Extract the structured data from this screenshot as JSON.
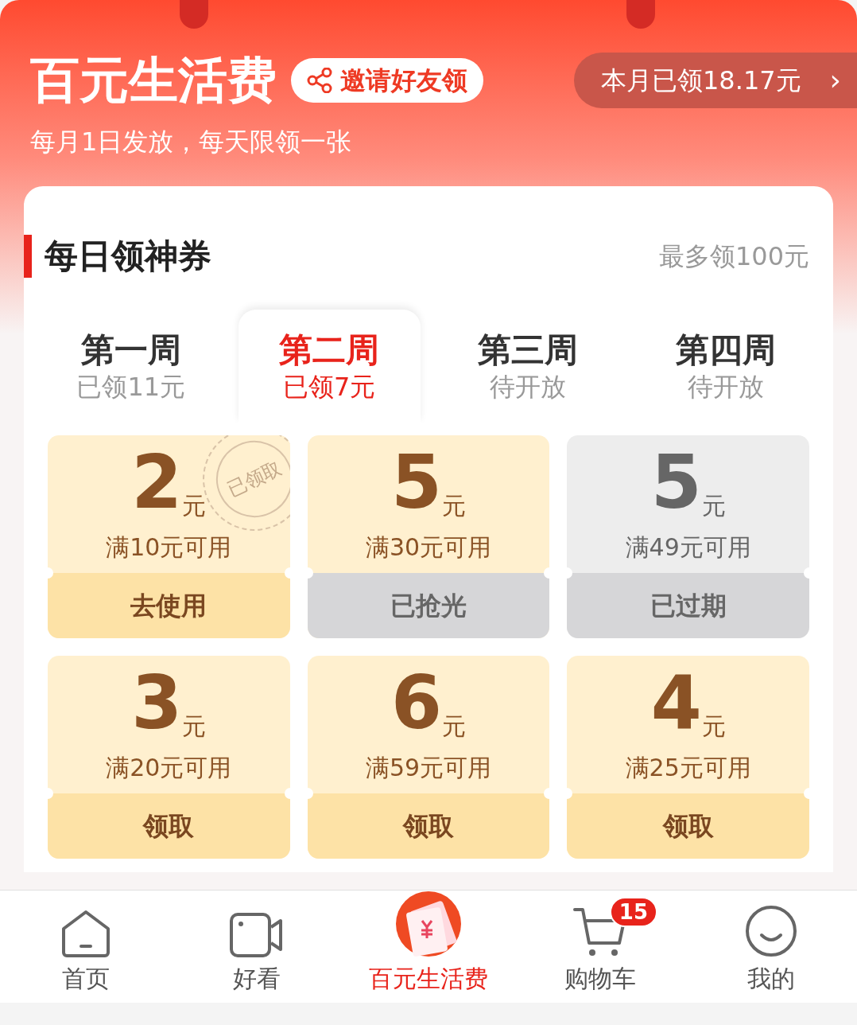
{
  "header": {
    "title": "百元生活费",
    "invite_button": "邀请好友领",
    "subtitle": "每月1日发放，每天限领一张",
    "monthly_claimed": "本月已领18.17元",
    "chevron": "›"
  },
  "section": {
    "title": "每日领神券",
    "limit": "最多领100元"
  },
  "weeks": [
    {
      "label": "第一周",
      "status": "已领11元",
      "selected": false
    },
    {
      "label": "第二周",
      "status": "已领7元",
      "selected": true
    },
    {
      "label": "第三周",
      "status": "待开放",
      "selected": false
    },
    {
      "label": "第四周",
      "status": "待开放",
      "selected": false
    }
  ],
  "coupons": [
    {
      "amount": "2",
      "unit": "元",
      "condition": "满10元可用",
      "action": "去使用",
      "kind": "active",
      "stamp": "已领取"
    },
    {
      "amount": "5",
      "unit": "元",
      "condition": "满30元可用",
      "action": "已抢光",
      "kind": "soldout"
    },
    {
      "amount": "5",
      "unit": "元",
      "condition": "满49元可用",
      "action": "已过期",
      "kind": "expired"
    },
    {
      "amount": "3",
      "unit": "元",
      "condition": "满20元可用",
      "action": "领取",
      "kind": "active"
    },
    {
      "amount": "6",
      "unit": "元",
      "condition": "满59元可用",
      "action": "领取",
      "kind": "active"
    },
    {
      "amount": "4",
      "unit": "元",
      "condition": "满25元可用",
      "action": "领取",
      "kind": "active"
    }
  ],
  "nav": [
    {
      "label": "首页",
      "selected": false
    },
    {
      "label": "好看",
      "selected": false
    },
    {
      "label": "百元生活费",
      "selected": true
    },
    {
      "label": "购物车",
      "selected": false,
      "badge": "15"
    },
    {
      "label": "我的",
      "selected": false
    }
  ]
}
